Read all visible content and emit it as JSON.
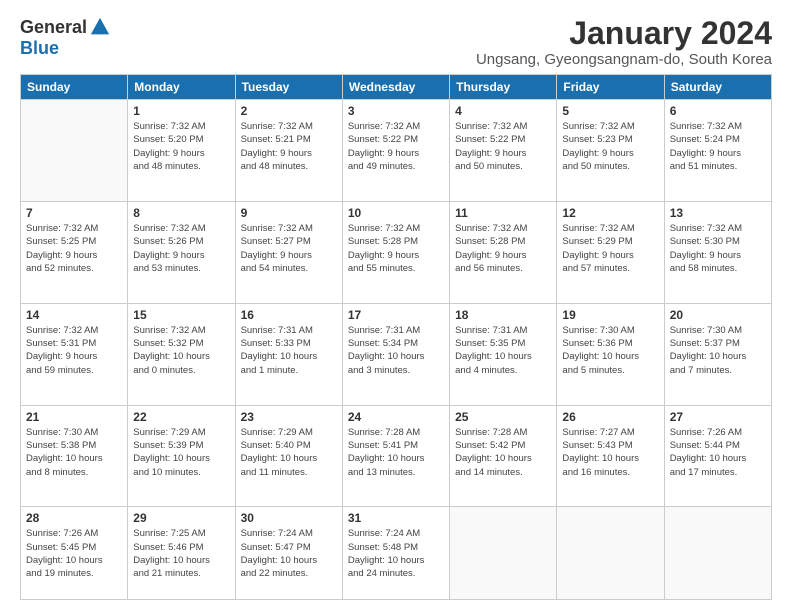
{
  "logo": {
    "general": "General",
    "blue": "Blue"
  },
  "title": "January 2024",
  "subtitle": "Ungsang, Gyeongsangnam-do, South Korea",
  "days_of_week": [
    "Sunday",
    "Monday",
    "Tuesday",
    "Wednesday",
    "Thursday",
    "Friday",
    "Saturday"
  ],
  "weeks": [
    [
      {
        "day": "",
        "info": ""
      },
      {
        "day": "1",
        "info": "Sunrise: 7:32 AM\nSunset: 5:20 PM\nDaylight: 9 hours\nand 48 minutes."
      },
      {
        "day": "2",
        "info": "Sunrise: 7:32 AM\nSunset: 5:21 PM\nDaylight: 9 hours\nand 48 minutes."
      },
      {
        "day": "3",
        "info": "Sunrise: 7:32 AM\nSunset: 5:22 PM\nDaylight: 9 hours\nand 49 minutes."
      },
      {
        "day": "4",
        "info": "Sunrise: 7:32 AM\nSunset: 5:22 PM\nDaylight: 9 hours\nand 50 minutes."
      },
      {
        "day": "5",
        "info": "Sunrise: 7:32 AM\nSunset: 5:23 PM\nDaylight: 9 hours\nand 50 minutes."
      },
      {
        "day": "6",
        "info": "Sunrise: 7:32 AM\nSunset: 5:24 PM\nDaylight: 9 hours\nand 51 minutes."
      }
    ],
    [
      {
        "day": "7",
        "info": "Sunrise: 7:32 AM\nSunset: 5:25 PM\nDaylight: 9 hours\nand 52 minutes."
      },
      {
        "day": "8",
        "info": "Sunrise: 7:32 AM\nSunset: 5:26 PM\nDaylight: 9 hours\nand 53 minutes."
      },
      {
        "day": "9",
        "info": "Sunrise: 7:32 AM\nSunset: 5:27 PM\nDaylight: 9 hours\nand 54 minutes."
      },
      {
        "day": "10",
        "info": "Sunrise: 7:32 AM\nSunset: 5:28 PM\nDaylight: 9 hours\nand 55 minutes."
      },
      {
        "day": "11",
        "info": "Sunrise: 7:32 AM\nSunset: 5:28 PM\nDaylight: 9 hours\nand 56 minutes."
      },
      {
        "day": "12",
        "info": "Sunrise: 7:32 AM\nSunset: 5:29 PM\nDaylight: 9 hours\nand 57 minutes."
      },
      {
        "day": "13",
        "info": "Sunrise: 7:32 AM\nSunset: 5:30 PM\nDaylight: 9 hours\nand 58 minutes."
      }
    ],
    [
      {
        "day": "14",
        "info": "Sunrise: 7:32 AM\nSunset: 5:31 PM\nDaylight: 9 hours\nand 59 minutes."
      },
      {
        "day": "15",
        "info": "Sunrise: 7:32 AM\nSunset: 5:32 PM\nDaylight: 10 hours\nand 0 minutes."
      },
      {
        "day": "16",
        "info": "Sunrise: 7:31 AM\nSunset: 5:33 PM\nDaylight: 10 hours\nand 1 minute."
      },
      {
        "day": "17",
        "info": "Sunrise: 7:31 AM\nSunset: 5:34 PM\nDaylight: 10 hours\nand 3 minutes."
      },
      {
        "day": "18",
        "info": "Sunrise: 7:31 AM\nSunset: 5:35 PM\nDaylight: 10 hours\nand 4 minutes."
      },
      {
        "day": "19",
        "info": "Sunrise: 7:30 AM\nSunset: 5:36 PM\nDaylight: 10 hours\nand 5 minutes."
      },
      {
        "day": "20",
        "info": "Sunrise: 7:30 AM\nSunset: 5:37 PM\nDaylight: 10 hours\nand 7 minutes."
      }
    ],
    [
      {
        "day": "21",
        "info": "Sunrise: 7:30 AM\nSunset: 5:38 PM\nDaylight: 10 hours\nand 8 minutes."
      },
      {
        "day": "22",
        "info": "Sunrise: 7:29 AM\nSunset: 5:39 PM\nDaylight: 10 hours\nand 10 minutes."
      },
      {
        "day": "23",
        "info": "Sunrise: 7:29 AM\nSunset: 5:40 PM\nDaylight: 10 hours\nand 11 minutes."
      },
      {
        "day": "24",
        "info": "Sunrise: 7:28 AM\nSunset: 5:41 PM\nDaylight: 10 hours\nand 13 minutes."
      },
      {
        "day": "25",
        "info": "Sunrise: 7:28 AM\nSunset: 5:42 PM\nDaylight: 10 hours\nand 14 minutes."
      },
      {
        "day": "26",
        "info": "Sunrise: 7:27 AM\nSunset: 5:43 PM\nDaylight: 10 hours\nand 16 minutes."
      },
      {
        "day": "27",
        "info": "Sunrise: 7:26 AM\nSunset: 5:44 PM\nDaylight: 10 hours\nand 17 minutes."
      }
    ],
    [
      {
        "day": "28",
        "info": "Sunrise: 7:26 AM\nSunset: 5:45 PM\nDaylight: 10 hours\nand 19 minutes."
      },
      {
        "day": "29",
        "info": "Sunrise: 7:25 AM\nSunset: 5:46 PM\nDaylight: 10 hours\nand 21 minutes."
      },
      {
        "day": "30",
        "info": "Sunrise: 7:24 AM\nSunset: 5:47 PM\nDaylight: 10 hours\nand 22 minutes."
      },
      {
        "day": "31",
        "info": "Sunrise: 7:24 AM\nSunset: 5:48 PM\nDaylight: 10 hours\nand 24 minutes."
      },
      {
        "day": "",
        "info": ""
      },
      {
        "day": "",
        "info": ""
      },
      {
        "day": "",
        "info": ""
      }
    ]
  ]
}
